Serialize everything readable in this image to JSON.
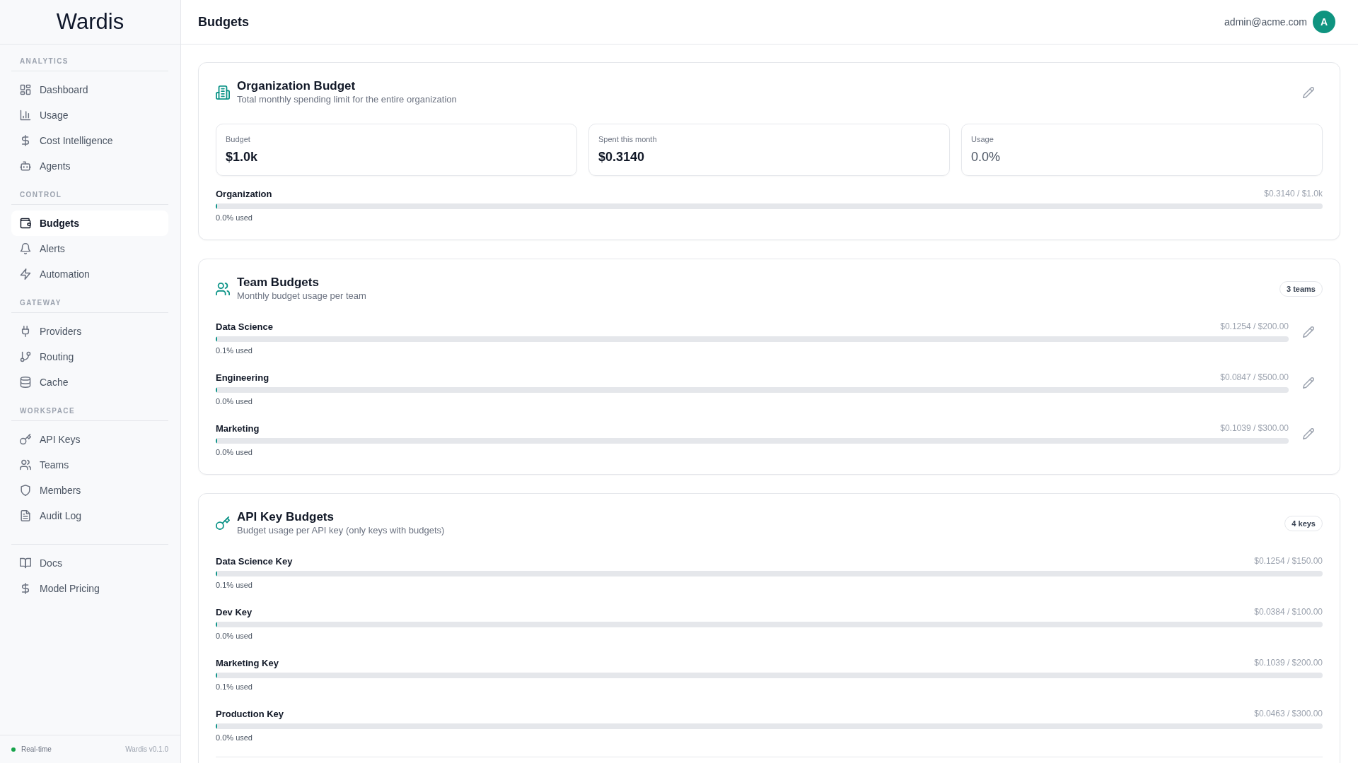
{
  "sidebar": {
    "logo": "Wardis",
    "sections": [
      {
        "label": "ANALYTICS",
        "items": [
          {
            "label": "Dashboard",
            "selected": false
          },
          {
            "label": "Usage",
            "selected": false
          },
          {
            "label": "Cost Intelligence",
            "selected": false
          },
          {
            "label": "Agents",
            "selected": false
          }
        ]
      },
      {
        "label": "CONTROL",
        "items": [
          {
            "label": "Budgets",
            "selected": true
          },
          {
            "label": "Alerts",
            "selected": false
          },
          {
            "label": "Automation",
            "selected": false
          }
        ]
      },
      {
        "label": "GATEWAY",
        "items": [
          {
            "label": "Providers",
            "selected": false
          },
          {
            "label": "Routing",
            "selected": false
          },
          {
            "label": "Cache",
            "selected": false
          }
        ]
      },
      {
        "label": "WORKSPACE",
        "items": [
          {
            "label": "API Keys",
            "selected": false
          },
          {
            "label": "Teams",
            "selected": false
          },
          {
            "label": "Members",
            "selected": false
          },
          {
            "label": "Audit Log",
            "selected": false
          }
        ]
      },
      {
        "items": [
          {
            "label": "Docs",
            "selected": false
          },
          {
            "label": "Model Pricing",
            "selected": false
          }
        ]
      }
    ],
    "footer": {
      "status": "Real-time",
      "version": "Wardis v0.1.0"
    }
  },
  "header": {
    "title": "Budgets",
    "user_email": "admin@acme.com",
    "avatar_initial": "A"
  },
  "cards": [
    {
      "title": "Organization Budget",
      "subtitle": "Total monthly spending limit for the entire organization",
      "editable": true,
      "stats": [
        {
          "label": "Budget",
          "value": "$1.0k",
          "kind": "amount"
        },
        {
          "label": "Spent this month",
          "value": "$0.3140",
          "kind": "amount"
        },
        {
          "label": "Usage",
          "value": "0.0%",
          "kind": "percent"
        }
      ],
      "rows": [
        {
          "name": "Organization",
          "amount": "$0.3140 / $1.0k",
          "level": 0.0003,
          "usage": "0.0% used"
        }
      ]
    },
    {
      "title": "Team Budgets",
      "subtitle": "Monthly budget usage per team",
      "badge": "3 teams",
      "rows": [
        {
          "name": "Data Science",
          "amount": "$0.1254 / $200.00",
          "level": 0.0006,
          "usage": "0.1% used",
          "editable": true
        },
        {
          "name": "Engineering",
          "amount": "$0.0847 / $500.00",
          "level": 0.0002,
          "usage": "0.0% used",
          "editable": true
        },
        {
          "name": "Marketing",
          "amount": "$0.1039 / $300.00",
          "level": 0.0003,
          "usage": "0.0% used",
          "editable": true
        }
      ]
    },
    {
      "title": "API Key Budgets",
      "subtitle": "Budget usage per API key (only keys with budgets)",
      "badge": "4 keys",
      "rows": [
        {
          "name": "Data Science Key",
          "amount": "$0.1254 / $150.00",
          "level": 0.0008,
          "usage": "0.1% used"
        },
        {
          "name": "Dev Key",
          "amount": "$0.0384 / $100.00",
          "level": 0.0004,
          "usage": "0.0% used"
        },
        {
          "name": "Marketing Key",
          "amount": "$0.1039 / $200.00",
          "level": 0.0005,
          "usage": "0.1% used"
        },
        {
          "name": "Production Key",
          "amount": "$0.0463 / $300.00",
          "level": 0.0002,
          "usage": "0.0% used"
        }
      ]
    }
  ]
}
